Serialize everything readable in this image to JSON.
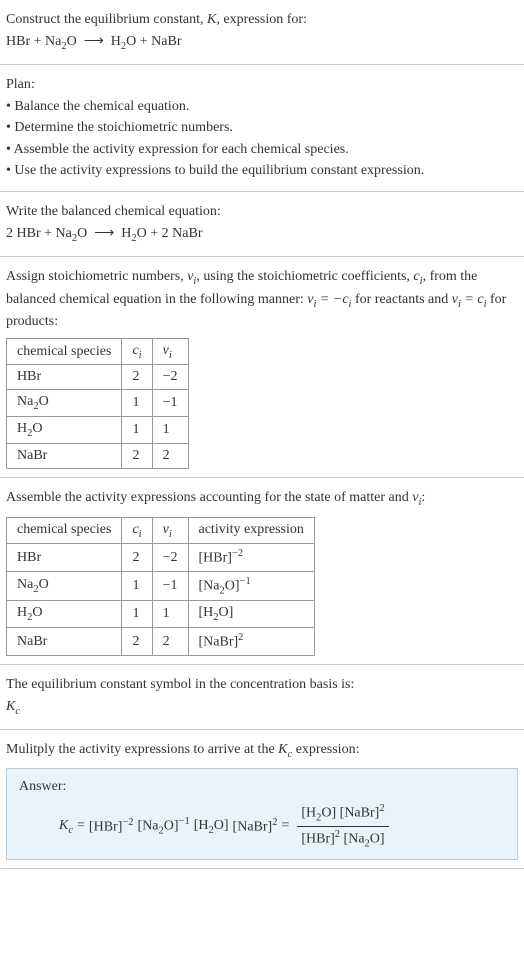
{
  "prompt": {
    "line1_a": "Construct the equilibrium constant, ",
    "line1_b": ", expression for:",
    "equation_lhs1": "HBr + Na",
    "equation_lhs2": "O",
    "arrow": "⟶",
    "equation_rhs1": "H",
    "equation_rhs2": "O + NaBr"
  },
  "plan": {
    "heading": "Plan:",
    "bullets": [
      "• Balance the chemical equation.",
      "• Determine the stoichiometric numbers.",
      "• Assemble the activity expression for each chemical species.",
      "• Use the activity expressions to build the equilibrium constant expression."
    ]
  },
  "balanced": {
    "heading": "Write the balanced chemical equation:",
    "lhs1": "2 HBr + Na",
    "lhs2": "O",
    "arrow": "⟶",
    "rhs1": "H",
    "rhs2": "O + 2 NaBr"
  },
  "stoich": {
    "intro_a": "Assign stoichiometric numbers, ",
    "intro_b": ", using the stoichiometric coefficients, ",
    "intro_c": ", from the balanced chemical equation in the following manner: ",
    "intro_d": " for reactants and ",
    "intro_e": " for products:",
    "nu_i": "ν",
    "c_i": "c",
    "eq1_lhs": "ν",
    "eq1_mid": " = −",
    "eq1_rhs": "c",
    "eq2_lhs": "ν",
    "eq2_mid": " = ",
    "eq2_rhs": "c",
    "headers": {
      "species": "chemical species",
      "ci": "c",
      "nui": "ν"
    },
    "rows": [
      {
        "species": "HBr",
        "ci": "2",
        "nui": "−2"
      },
      {
        "species_a": "Na",
        "species_b": "O",
        "ci": "1",
        "nui": "−1"
      },
      {
        "species_a": "H",
        "species_b": "O",
        "ci": "1",
        "nui": "1"
      },
      {
        "species": "NaBr",
        "ci": "2",
        "nui": "2"
      }
    ]
  },
  "activity": {
    "intro_a": "Assemble the activity expressions accounting for the state of matter and ",
    "intro_b": ":",
    "headers": {
      "species": "chemical species",
      "ci": "c",
      "nui": "ν",
      "act": "activity expression"
    },
    "rows": [
      {
        "species": "HBr",
        "ci": "2",
        "nui": "−2",
        "act_base": "[HBr]",
        "act_exp": "−2"
      },
      {
        "species_a": "Na",
        "species_b": "O",
        "ci": "1",
        "nui": "−1",
        "act_base_a": "[Na",
        "act_base_b": "O]",
        "act_exp": "−1"
      },
      {
        "species_a": "H",
        "species_b": "O",
        "ci": "1",
        "nui": "1",
        "act_base_a": "[H",
        "act_base_b": "O]",
        "act_exp": ""
      },
      {
        "species": "NaBr",
        "ci": "2",
        "nui": "2",
        "act_base": "[NaBr]",
        "act_exp": "2"
      }
    ]
  },
  "symbol": {
    "line": "The equilibrium constant symbol in the concentration basis is:",
    "K": "K",
    "c": "c"
  },
  "multiply": {
    "intro_a": "Mulitply the activity expressions to arrive at the ",
    "intro_b": " expression:"
  },
  "answer": {
    "label": "Answer:",
    "Kc_K": "K",
    "Kc_c": "c",
    "eq": " = ",
    "t1_base": "[HBr]",
    "t1_exp": "−2",
    "t2_base_a": "[Na",
    "t2_base_b": "O]",
    "t2_exp": "−1",
    "t3_base_a": "[H",
    "t3_base_b": "O]",
    "t4_base": "[NaBr]",
    "t4_exp": "2",
    "eq2": " = ",
    "num_a": "[H",
    "num_b": "O] [NaBr]",
    "num_exp": "2",
    "den_a": "[HBr]",
    "den_exp1": "2",
    "den_b": " [Na",
    "den_c": "O]"
  },
  "chart_data": {
    "type": "table",
    "tables": [
      {
        "title": "Stoichiometric numbers",
        "columns": [
          "chemical species",
          "c_i",
          "ν_i"
        ],
        "rows": [
          [
            "HBr",
            2,
            -2
          ],
          [
            "Na2O",
            1,
            -1
          ],
          [
            "H2O",
            1,
            1
          ],
          [
            "NaBr",
            2,
            2
          ]
        ]
      },
      {
        "title": "Activity expressions",
        "columns": [
          "chemical species",
          "c_i",
          "ν_i",
          "activity expression"
        ],
        "rows": [
          [
            "HBr",
            2,
            -2,
            "[HBr]^-2"
          ],
          [
            "Na2O",
            1,
            -1,
            "[Na2O]^-1"
          ],
          [
            "H2O",
            1,
            1,
            "[H2O]"
          ],
          [
            "NaBr",
            2,
            2,
            "[NaBr]^2"
          ]
        ]
      }
    ]
  }
}
